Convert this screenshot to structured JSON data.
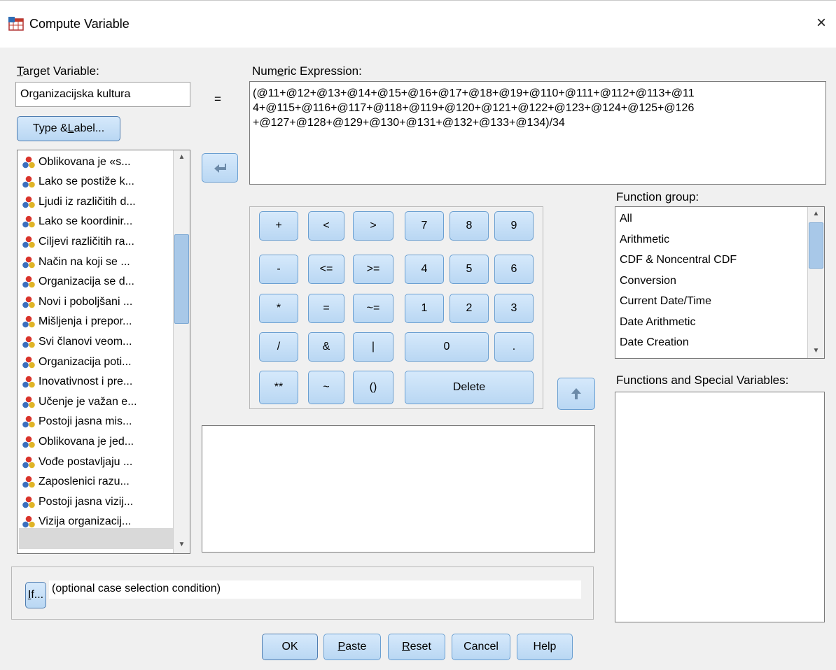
{
  "window": {
    "title": "Compute Variable",
    "close_label": "×"
  },
  "target": {
    "label_prefix": "T",
    "label_rest": "arget Variable:",
    "value": "Organizacijska kultura",
    "equals": "="
  },
  "type_label_button": {
    "pre": "Type & ",
    "mnemonic": "L",
    "post": "abel..."
  },
  "numeric_expression": {
    "label_pre": "Num",
    "label_mnemonic": "e",
    "label_post": "ric Expression:",
    "line1": "(@11+@12+@13+@14+@15+@16+@17+@18+@19+@110+@111+@112+@113+@11",
    "line2": "4+@115+@116+@117+@118+@119+@120+@121+@122+@123+@124+@125+@126",
    "line3": "+@127+@128+@129+@130+@131+@132+@133+@134)/34"
  },
  "variables": [
    "Oblikovana je «s...",
    "Lako se postiže k...",
    "Ljudi iz različitih d...",
    "Lako se koordinir...",
    "Ciljevi različitih ra...",
    "Način na koji se ...",
    "Organizacija se d...",
    "Novi i poboljšani ...",
    "Mišljenja i prepor...",
    "Svi članovi veom...",
    "Organizacija poti...",
    "Inovativnost i pre...",
    "Učenje je važan e...",
    "Postoji jasna mis...",
    "Oblikovana je jed...",
    "Vođe postavljaju ...",
    "Zaposlenici razu...",
    "Postoji jasna vizij...",
    "Vizija organizacij..."
  ],
  "keypad": {
    "plus": "+",
    "lt": "<",
    "gt": ">",
    "k7": "7",
    "k8": "8",
    "k9": "9",
    "minus": "-",
    "le": "<=",
    "ge": ">=",
    "k4": "4",
    "k5": "5",
    "k6": "6",
    "mult": "*",
    "eq": "=",
    "ne": "~=",
    "k1": "1",
    "k2": "2",
    "k3": "3",
    "div": "/",
    "and": "&",
    "or": "|",
    "k0": "0",
    "dot": ".",
    "pow": "**",
    "not": "~",
    "parens": "()",
    "delete": "Delete"
  },
  "function_group": {
    "label_pre": "Function ",
    "label_mnemonic": "g",
    "label_post": "roup:",
    "items": [
      "All",
      "Arithmetic",
      "CDF & Noncentral CDF",
      "Conversion",
      "Current Date/Time",
      "Date Arithmetic",
      "Date Creation"
    ]
  },
  "functions_special": {
    "label": "Functions and Special Variables:"
  },
  "if_section": {
    "button_mnemonic": "I",
    "button_rest": "f...",
    "condition": "(optional case selection condition)"
  },
  "bottom_buttons": {
    "ok": "OK",
    "paste_mnemonic": "P",
    "paste_rest": "aste",
    "reset_mnemonic": "R",
    "reset_rest": "eset",
    "cancel": "Cancel",
    "help": "Help"
  },
  "colors": {
    "button_top": "#d6e9fb",
    "button_bottom": "#b9d7f3",
    "button_border": "#6a9fd1",
    "selection": "#d9d9d9",
    "scroll_thumb": "#a8c8e8"
  },
  "icons": {
    "window_icon": "spss-compute-icon",
    "variable_icon": "nominal-variable-icon",
    "transfer_left": "arrow-left-icon",
    "transfer_up": "arrow-up-icon"
  }
}
